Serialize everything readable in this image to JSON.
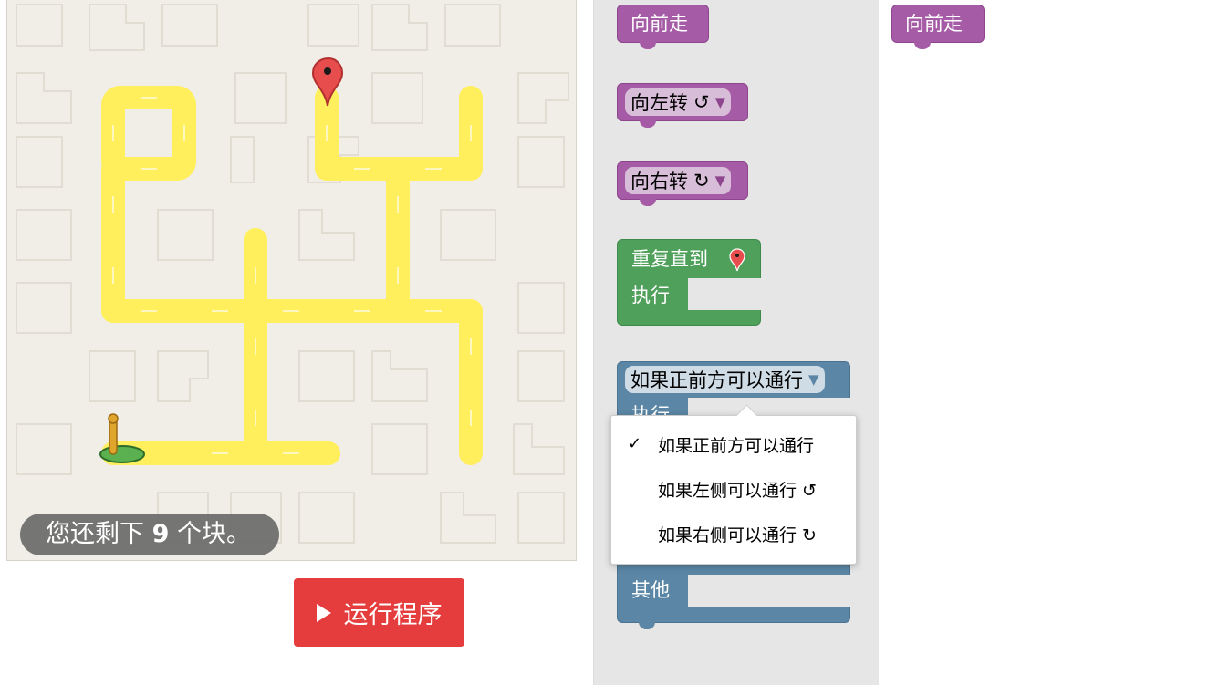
{
  "status": {
    "blocks_left_prefix": "您还剩下",
    "blocks_left_count": "9",
    "blocks_left_suffix": "个块。"
  },
  "run_button": {
    "label": "运行程序"
  },
  "toolbox": {
    "move_forward": "向前走",
    "turn_left": {
      "label": "向左转",
      "symbol": "↺"
    },
    "turn_right": {
      "label": "向右转",
      "symbol": "↻"
    },
    "repeat_until": {
      "label": "重复直到",
      "do": "执行"
    },
    "if_else": {
      "condition": "如果正前方可以通行",
      "do": "执行",
      "else": "其他"
    }
  },
  "dropdown_menu": {
    "items": [
      {
        "label": "如果正前方可以通行",
        "checked": "✓"
      },
      {
        "label": "如果左侧可以通行 ↺"
      },
      {
        "label": "如果右侧可以通行 ↻"
      }
    ]
  },
  "workspace": {
    "move_forward": "向前走"
  },
  "colors": {
    "motion_block": "#a55ba5",
    "loop_block": "#4fa05b",
    "logic_block": "#5b86a5",
    "path": "#fff157",
    "run_button": "#e53d3d"
  }
}
